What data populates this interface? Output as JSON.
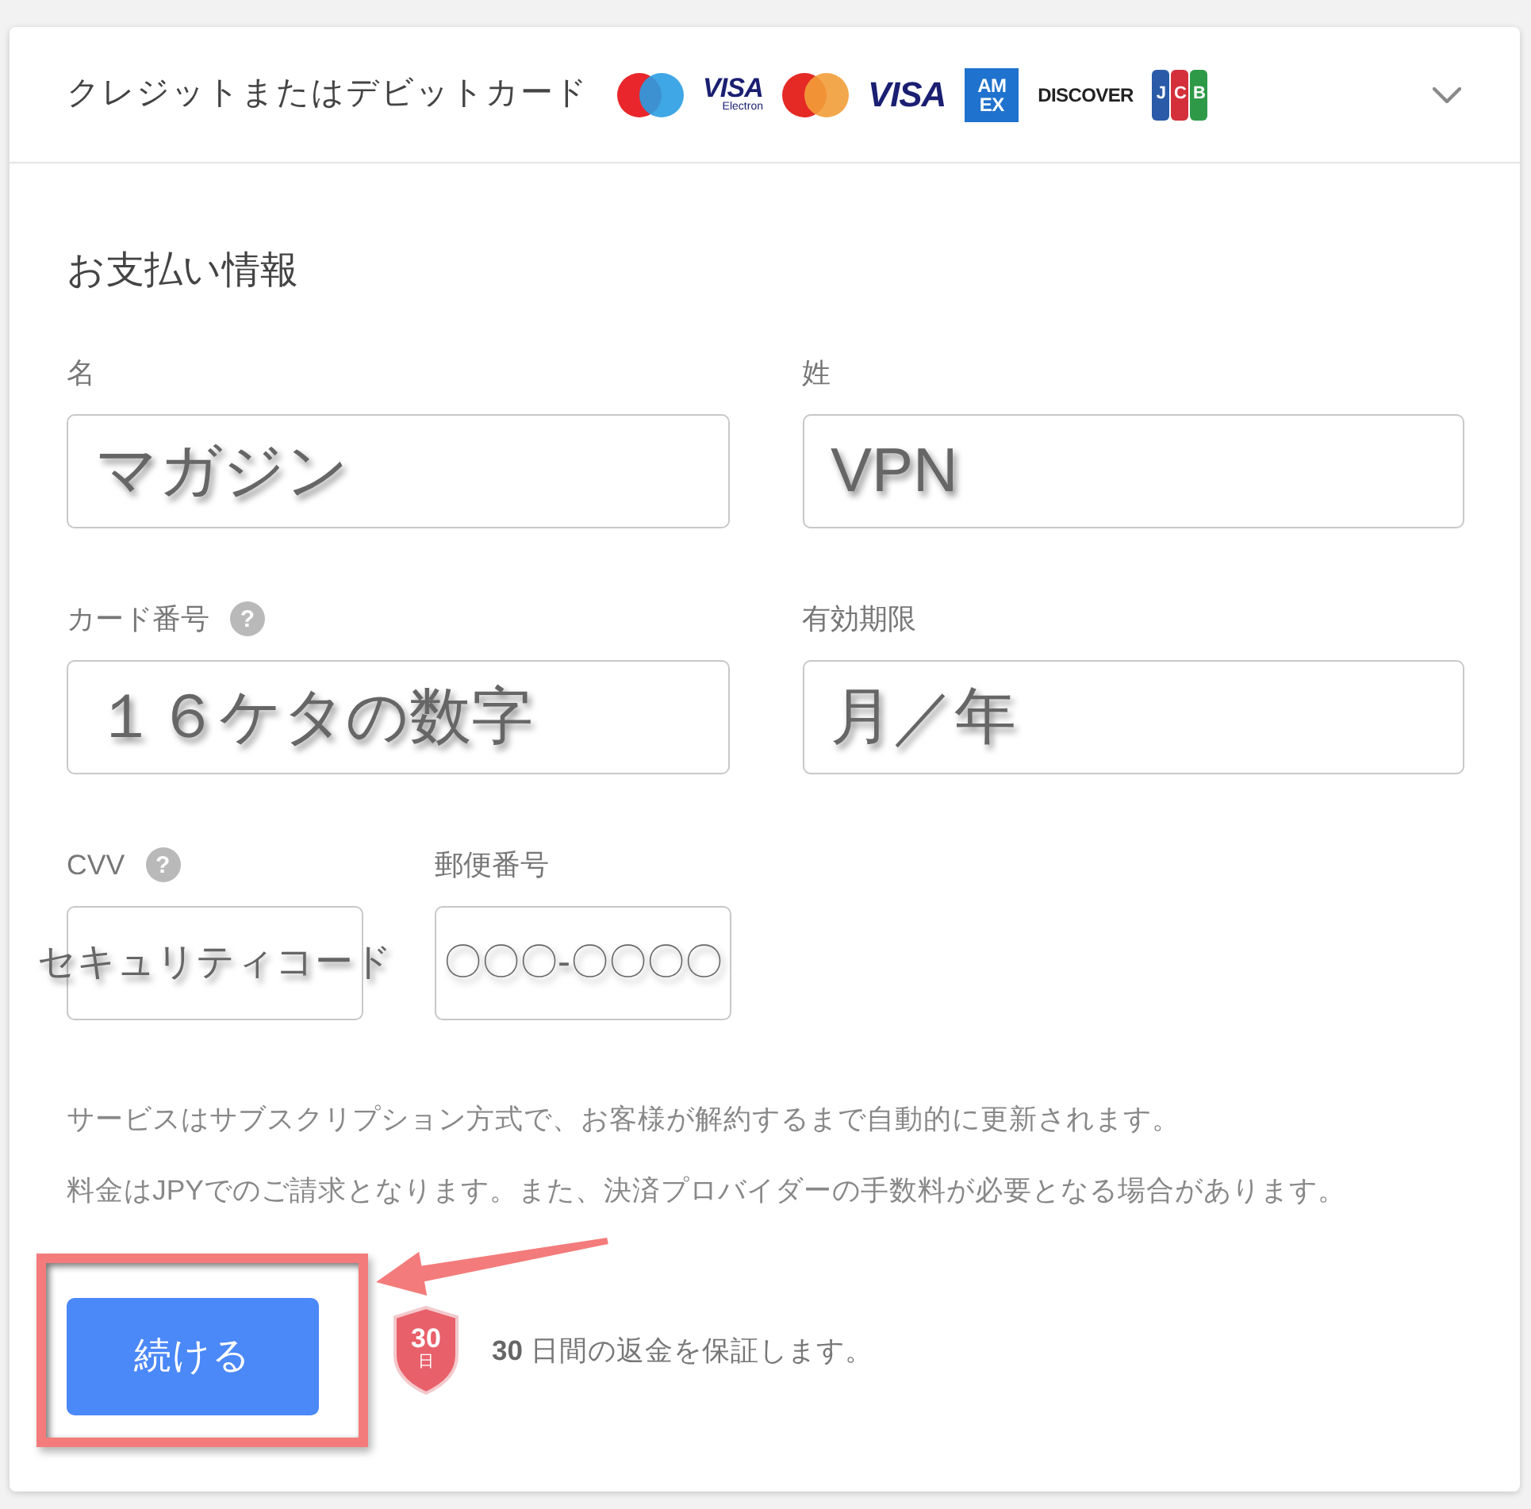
{
  "payment_method": {
    "title": "クレジットまたはデビットカード",
    "card_logos": [
      {
        "kind": "maestro"
      },
      {
        "kind": "wordmark",
        "text": "VISA",
        "subtext": "Electron"
      },
      {
        "kind": "mastercard"
      },
      {
        "kind": "wordmark",
        "text": "VISA"
      },
      {
        "kind": "tile",
        "lines": [
          "AM",
          "EX"
        ]
      },
      {
        "kind": "discover",
        "text": "DISCOVER"
      },
      {
        "kind": "jcb",
        "tiles": [
          {
            "text": "J",
            "color": "#2b5aa8"
          },
          {
            "text": "C",
            "color": "#d3303c"
          },
          {
            "text": "B",
            "color": "#2e9a48"
          }
        ]
      }
    ]
  },
  "payment_info": {
    "heading": "お支払い情報",
    "rows": [
      [
        {
          "label": "名",
          "annotation": "マガジン"
        },
        {
          "label": "姓",
          "annotation": "VPN"
        }
      ],
      [
        {
          "label": "カード番号",
          "help": "?",
          "annotation": "１６ケタの数字"
        },
        {
          "label": "有効期限",
          "annotation": "月／年"
        }
      ],
      [
        {
          "label": "CVV",
          "help": "?",
          "annotation": "セキュリティコード"
        },
        {
          "label": "郵便番号",
          "annotation": "〇〇〇-〇〇〇〇"
        }
      ]
    ]
  },
  "notes": [
    "サービスはサブスクリプション方式で、お客様が解約するまで自動的に更新されます。",
    "料金はJPYでのご請求となります。また、決済プロバイダーの手数料が必要となる場合があります。"
  ],
  "continue_button": {
    "label": "続ける",
    "highlighted": true
  },
  "guarantee": {
    "badge_number": "30",
    "badge_unit": "日",
    "text": "**30** 日間の返金を保証します。"
  }
}
